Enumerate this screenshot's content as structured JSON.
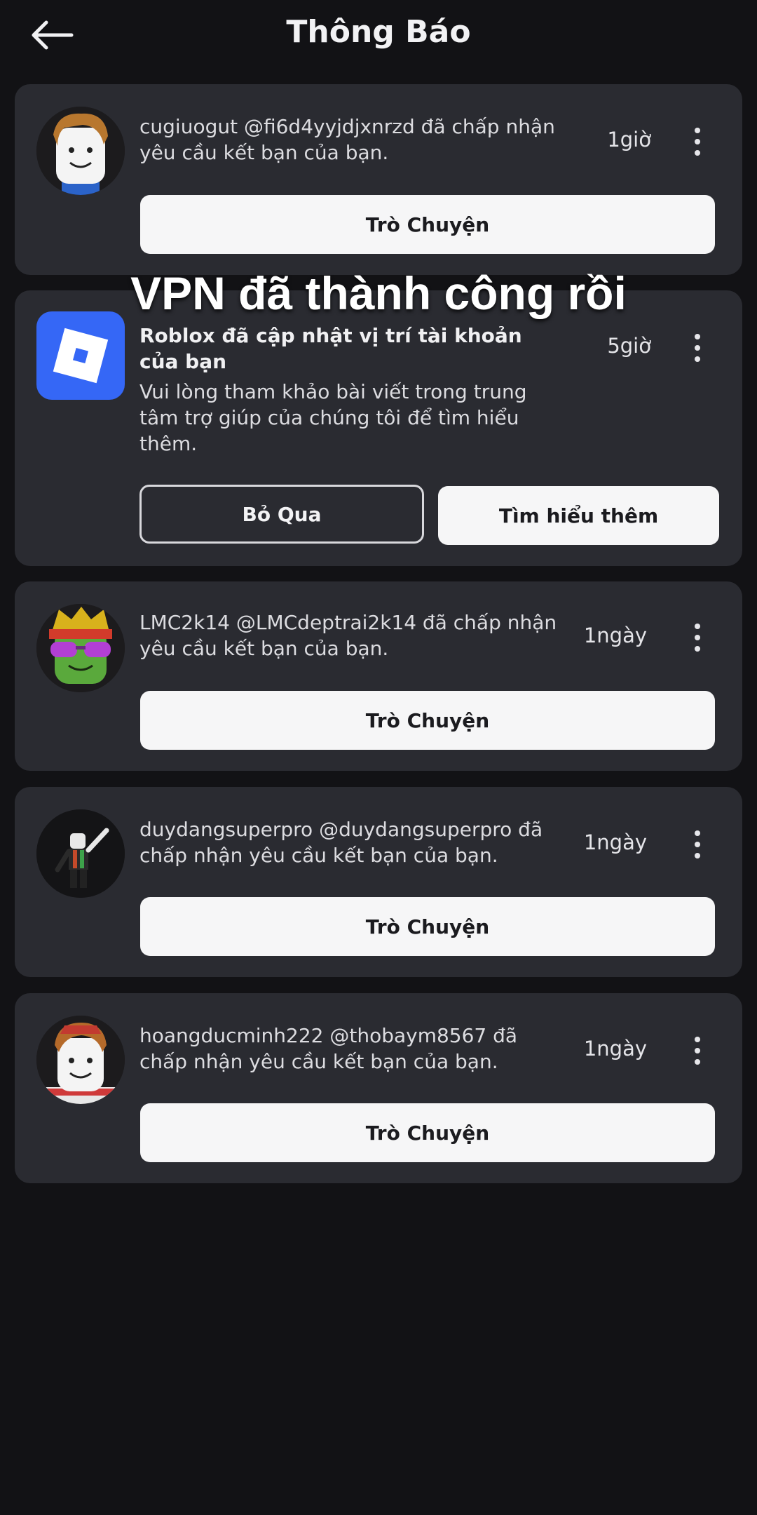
{
  "header": {
    "title": "Thông Báo",
    "back_icon": "arrow-left-icon"
  },
  "overlay_caption": "VPN đã thành công rồi",
  "notifications": [
    {
      "text": "cugiuogut @fi6d4yyjdjxnrzd đã chấp nhận yêu cầu kết bạn của bạn.",
      "time": "1giờ",
      "button": "Trò Chuyện"
    },
    {
      "title": "Roblox đã cập nhật vị trí tài khoản của bạn",
      "text": "Vui lòng tham khảo bài viết trong trung tâm trợ giúp của chúng tôi để tìm hiểu thêm.",
      "time": "5giờ",
      "buttons": [
        "Bỏ Qua",
        "Tìm hiểu thêm"
      ]
    },
    {
      "text": "LMC2k14 @LMCdeptrai2k14 đã chấp nhận yêu cầu kết bạn của bạn.",
      "time": "1ngày",
      "button": "Trò Chuyện"
    },
    {
      "text": "duydangsuperpro @duydangsuperpro đã chấp nhận yêu cầu kết bạn của bạn.",
      "time": "1ngày",
      "button": "Trò Chuyện"
    },
    {
      "text": "hoangducminh222 @thobaym8567 đã chấp nhận yêu cầu kết bạn của bạn.",
      "time": "1ngày",
      "button": "Trò Chuyện"
    }
  ],
  "colors": {
    "background": "#121215",
    "card": "#2a2b31",
    "button": "#f6f6f7",
    "roblox_blue": "#3567f6"
  }
}
